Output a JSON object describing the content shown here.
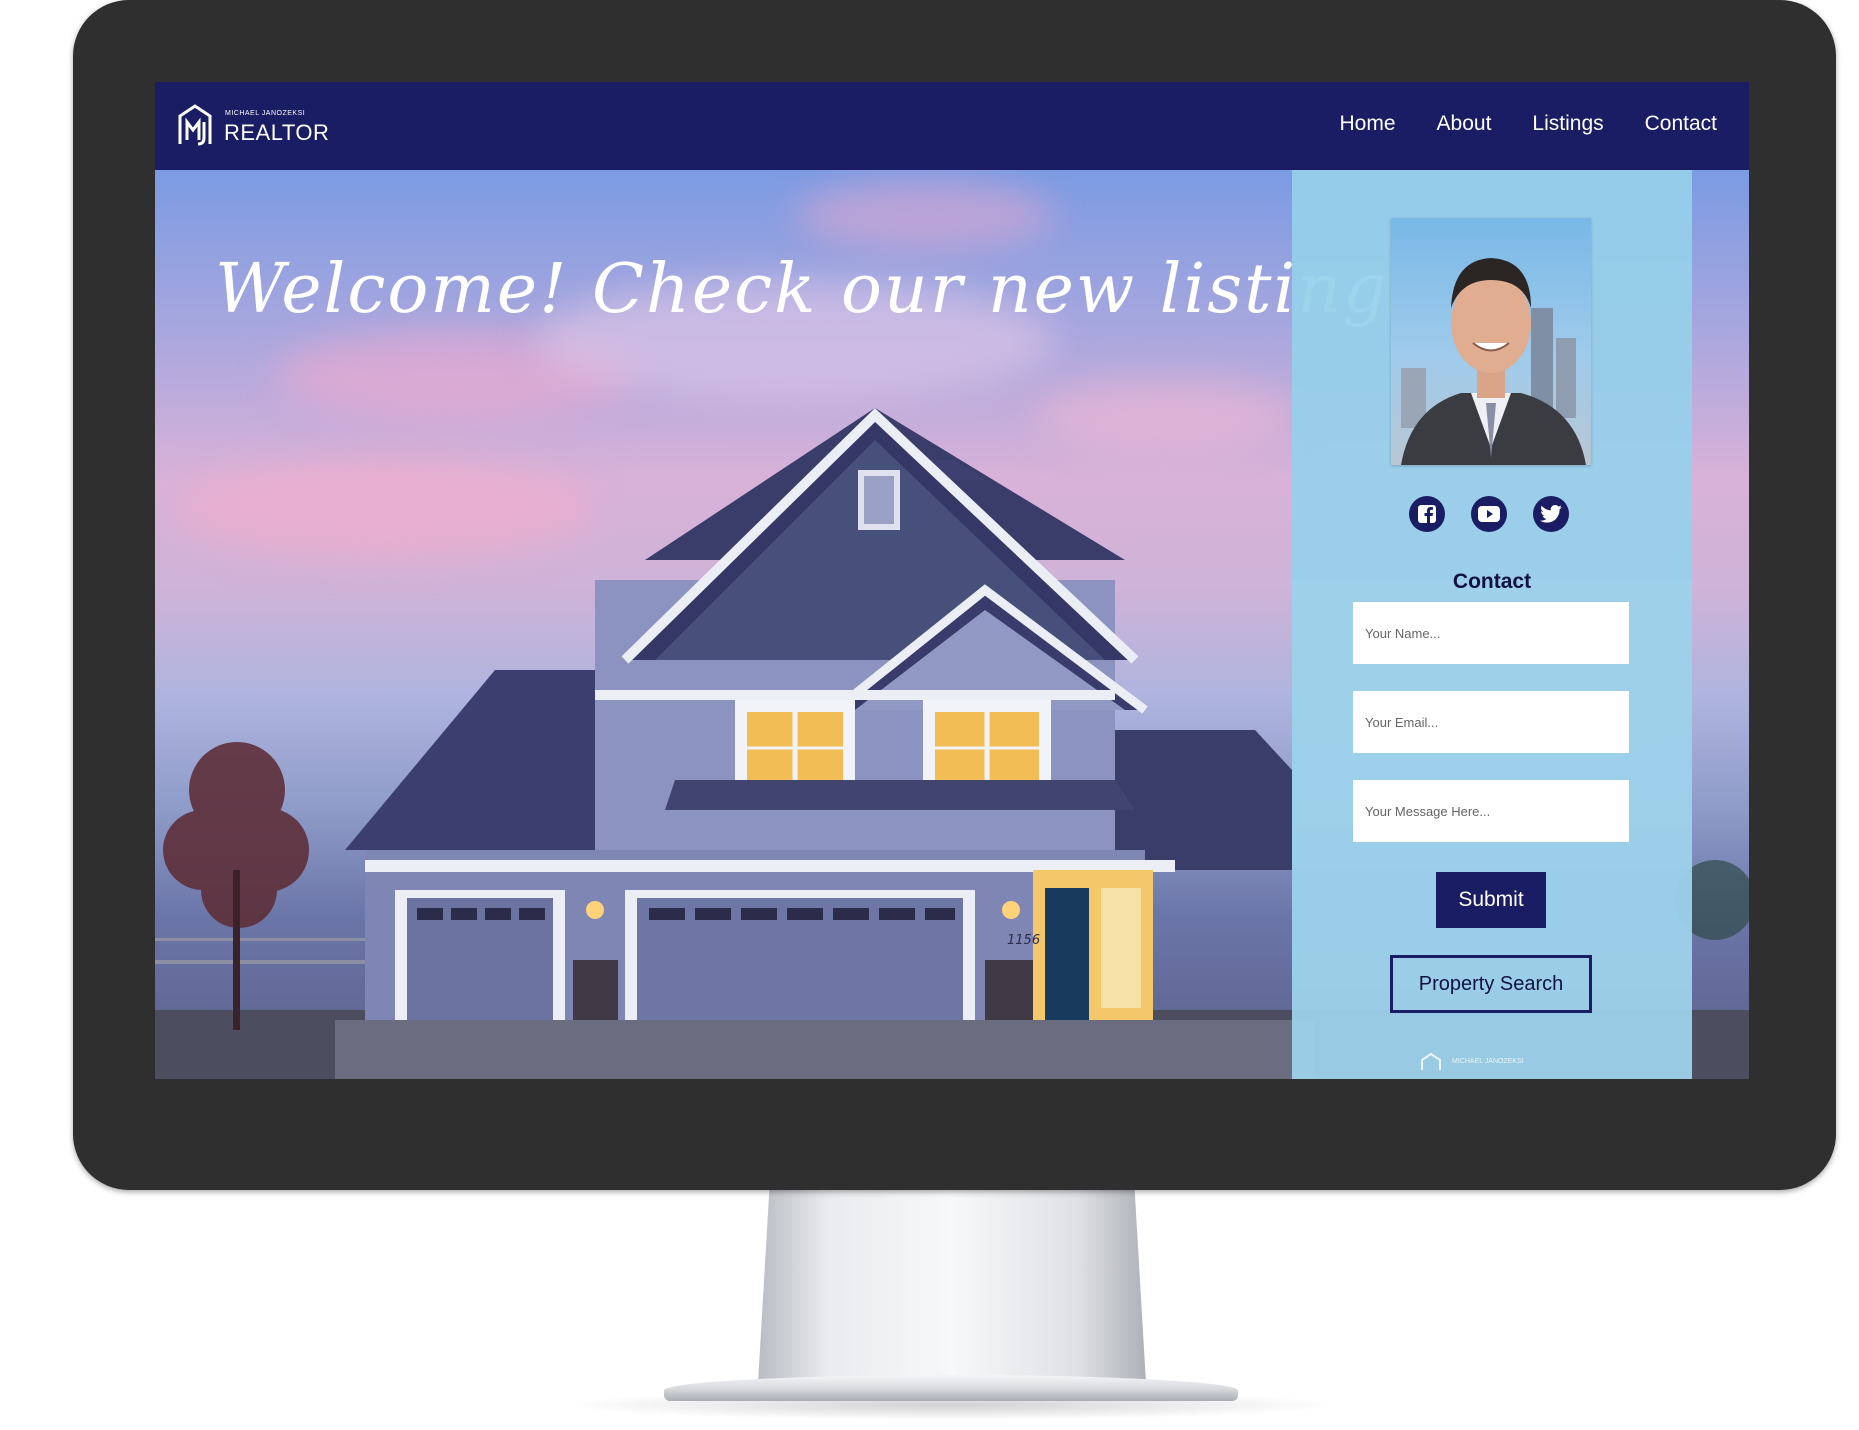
{
  "brand": {
    "name_small": "MICHAEL JANOZEKSI",
    "name_big": "REALTOR",
    "primary_color": "#1a1d63",
    "panel_color": "#96d0ea"
  },
  "nav": {
    "items": [
      {
        "label": "Home"
      },
      {
        "label": "About"
      },
      {
        "label": "Listings"
      },
      {
        "label": "Contact"
      }
    ]
  },
  "hero": {
    "headline": "Welcome! Check our new listings",
    "house_number": "1156"
  },
  "sidebar": {
    "socials": [
      {
        "icon": "facebook-icon"
      },
      {
        "icon": "youtube-icon"
      },
      {
        "icon": "twitter-icon"
      }
    ],
    "contact_title": "Contact",
    "form": {
      "name_placeholder": "Your Name...",
      "email_placeholder": "Your Email...",
      "message_placeholder": "Your Message Here...",
      "submit_label": "Submit"
    },
    "property_search_label": "Property Search",
    "footer_small": "MICHAEL JANOZEKSI"
  }
}
